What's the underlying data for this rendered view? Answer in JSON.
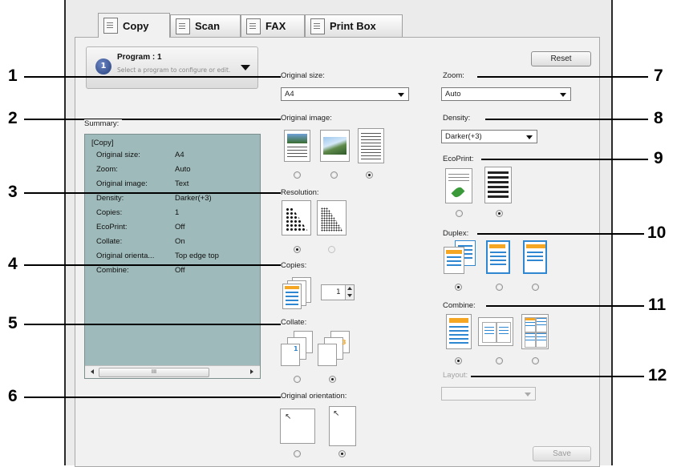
{
  "tabs": [
    {
      "label": "Copy"
    },
    {
      "label": "Scan"
    },
    {
      "label": "FAX"
    },
    {
      "label": "Print Box"
    }
  ],
  "program": {
    "badge": "1",
    "title": "Program : 1",
    "description": "Select a program to configure or edit."
  },
  "reset_label": "Reset",
  "save_label": "Save",
  "summary": {
    "label": "Summary:",
    "header": "[Copy]",
    "rows": [
      {
        "key": "Original size:",
        "value": "A4"
      },
      {
        "key": "Zoom:",
        "value": "Auto"
      },
      {
        "key": "Original image:",
        "value": "Text"
      },
      {
        "key": "Density:",
        "value": "Darker(+3)"
      },
      {
        "key": "Copies:",
        "value": "1"
      },
      {
        "key": "EcoPrint:",
        "value": "Off"
      },
      {
        "key": "Collate:",
        "value": "On"
      },
      {
        "key": "Original orienta...",
        "value": "Top edge top"
      },
      {
        "key": "Combine:",
        "value": "Off"
      }
    ],
    "scroll_thumb": "III"
  },
  "settings": {
    "original_size": {
      "label": "Original size:",
      "value": "A4"
    },
    "original_image": {
      "label": "Original image:",
      "selected_index": 2
    },
    "resolution": {
      "label": "Resolution:",
      "selected_index": 0
    },
    "copies": {
      "label": "Copies:",
      "value": "1"
    },
    "collate": {
      "label": "Collate:",
      "selected_index": 1
    },
    "original_orientation": {
      "label": "Original orientation:",
      "selected_index": 1
    },
    "zoom": {
      "label": "Zoom:",
      "value": "Auto"
    },
    "density": {
      "label": "Density:",
      "value": "Darker(+3)"
    },
    "ecoprint": {
      "label": "EcoPrint:",
      "selected_index": 1
    },
    "duplex": {
      "label": "Duplex:",
      "selected_index": 0
    },
    "combine": {
      "label": "Combine:",
      "selected_index": 0
    },
    "layout": {
      "label": "Layout:",
      "value": ""
    }
  },
  "callouts": [
    "1",
    "2",
    "3",
    "4",
    "5",
    "6",
    "7",
    "8",
    "9",
    "10",
    "11",
    "12"
  ],
  "colors": {
    "summary_bg": "#9fbaba",
    "panel_bg": "#f1f1f1",
    "doc_orange": "#f5a623",
    "doc_blue": "#2f86d1",
    "eco_green": "#3a9a3a"
  }
}
